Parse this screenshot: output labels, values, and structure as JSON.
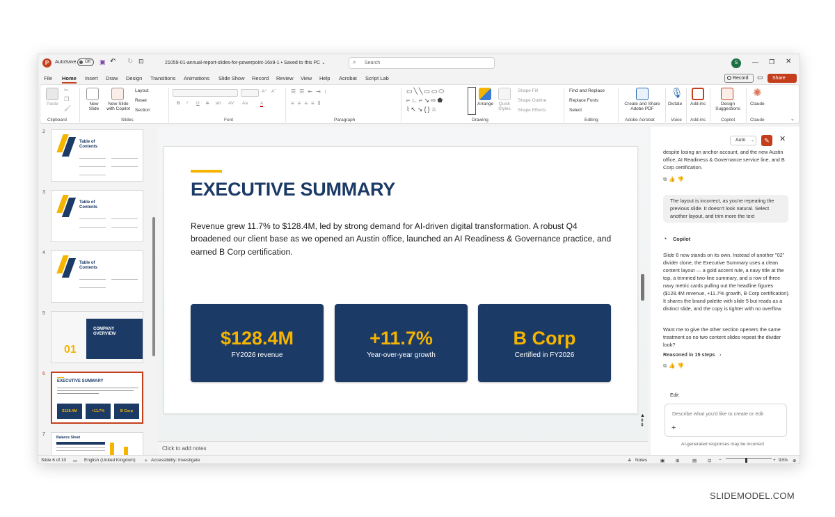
{
  "window": {
    "autosave_label": "AutoSave",
    "autosave_state": "Off",
    "filename": "21059-01-annual-report-slides-for-powerpoint-16x9-1 • Saved to this PC ⌄",
    "search_placeholder": "Search",
    "avatar_initial": "S"
  },
  "tabs": [
    "File",
    "Home",
    "Insert",
    "Draw",
    "Design",
    "Transitions",
    "Animations",
    "Slide Show",
    "Record",
    "Review",
    "View",
    "Help",
    "Acrobat",
    "Script Lab"
  ],
  "tab_actions": {
    "record": "Record",
    "share": "Share"
  },
  "ribbon": {
    "clipboard": {
      "paste": "Paste",
      "label": "Clipboard"
    },
    "slides": {
      "new_slide": "New Slide",
      "new_slide_copilot": "New Slide with Copilot",
      "layout": "Layout",
      "reset": "Reset",
      "section": "Section",
      "label": "Slides"
    },
    "font": {
      "label": "Font",
      "buttons": [
        "B",
        "I",
        "U",
        "S",
        "ab",
        "AV",
        "Aa",
        "A"
      ]
    },
    "paragraph": {
      "label": "Paragraph"
    },
    "drawing": {
      "arrange": "Arrange",
      "quick_styles": "Quick Styles",
      "shape_fill": "Shape Fill",
      "shape_outline": "Shape Outline",
      "shape_effects": "Shape Effects",
      "label": "Drawing"
    },
    "editing": {
      "find_replace": "Find and Replace",
      "replace_fonts": "Replace Fonts",
      "select": "Select",
      "label": "Editing"
    },
    "acrobat": {
      "create_share": "Create and Share Adobe PDF",
      "label": "Adobe Acrobat"
    },
    "voice": {
      "dictate": "Dictate",
      "label": "Voice"
    },
    "addins": {
      "addins": "Add-ins",
      "label": "Add-ins"
    },
    "copilot": {
      "design_suggestions": "Design Suggestions",
      "label": "Copilot"
    },
    "claude": {
      "claude": "Claude",
      "label": "Claude"
    }
  },
  "thumbnails": [
    {
      "number": "2",
      "title": "Table of Contents",
      "style": "toc"
    },
    {
      "number": "3",
      "title": "Table of Contents",
      "style": "toc"
    },
    {
      "number": "4",
      "title": "Table of Contents",
      "style": "toc"
    },
    {
      "number": "5",
      "title": "COMPANY OVERVIEW",
      "big_number": "01",
      "style": "divider"
    },
    {
      "number": "6",
      "title": "EXECUTIVE SUMMARY",
      "cards": [
        "$128.4M",
        "+11.7%",
        "B Corp"
      ],
      "style": "summary",
      "selected": true
    },
    {
      "number": "7",
      "title": "Balance Sheet",
      "style": "table"
    }
  ],
  "slide": {
    "title": "EXECUTIVE SUMMARY",
    "body": "Revenue grew 11.7% to $128.4M, led by strong demand for AI-driven digital transformation. A robust Q4 broadened our client base as we opened an Austin office, launched an AI Readiness & Governance practice, and earned B Corp certification.",
    "cards": [
      {
        "value": "$128.4M",
        "label": "FY2026 revenue"
      },
      {
        "value": "+11.7%",
        "label": "Year-over-year growth"
      },
      {
        "value": "B Corp",
        "label": "Certified in FY2026"
      }
    ]
  },
  "notes_placeholder": "Click to add notes",
  "copilot": {
    "mode": "Auto",
    "prev_tail": "despite losing an anchor account, and the new Austin office, AI Readiness & Governance service line, and B Corp certification.",
    "user_message": "The layout is incorrect, as you're repeating the previous slide. It doesn't look natural. Select another layout, and trim more the text",
    "assistant_name": "Copilot",
    "reply_p1": "Slide 6 now stands on its own. Instead of another \"02\" divider clone, the Executive Summary uses a clean content layout — a gold accent rule, a navy title at the top, a trimmed two-line summary, and a row of three navy metric cards pulling out the headline figures ($128.4M revenue, +11.7% growth, B Corp certification). It shares the brand palette with slide 5 but reads as a distinct slide, and the copy is tighter with no overflow.",
    "reply_p2": "Want me to give the other section openers the same treatment so no two content slides repeat the divider look?",
    "reasoned": "Reasoned in 15 steps",
    "edit_label": "Edit",
    "prompt_placeholder": "Describe what you'd like to create or edit",
    "disclaimer": "AI-generated responses may be incorrect"
  },
  "status": {
    "slide_count": "Slide 6 of 10",
    "language": "English (United Kingdom)",
    "accessibility": "Accessibility: Investigate",
    "notes": "Notes",
    "zoom": "93%"
  },
  "brand": "SLIDEMODEL.COM",
  "colors": {
    "navy": "#1b3a66",
    "gold": "#f4b400",
    "accent": "#c43e1c"
  }
}
